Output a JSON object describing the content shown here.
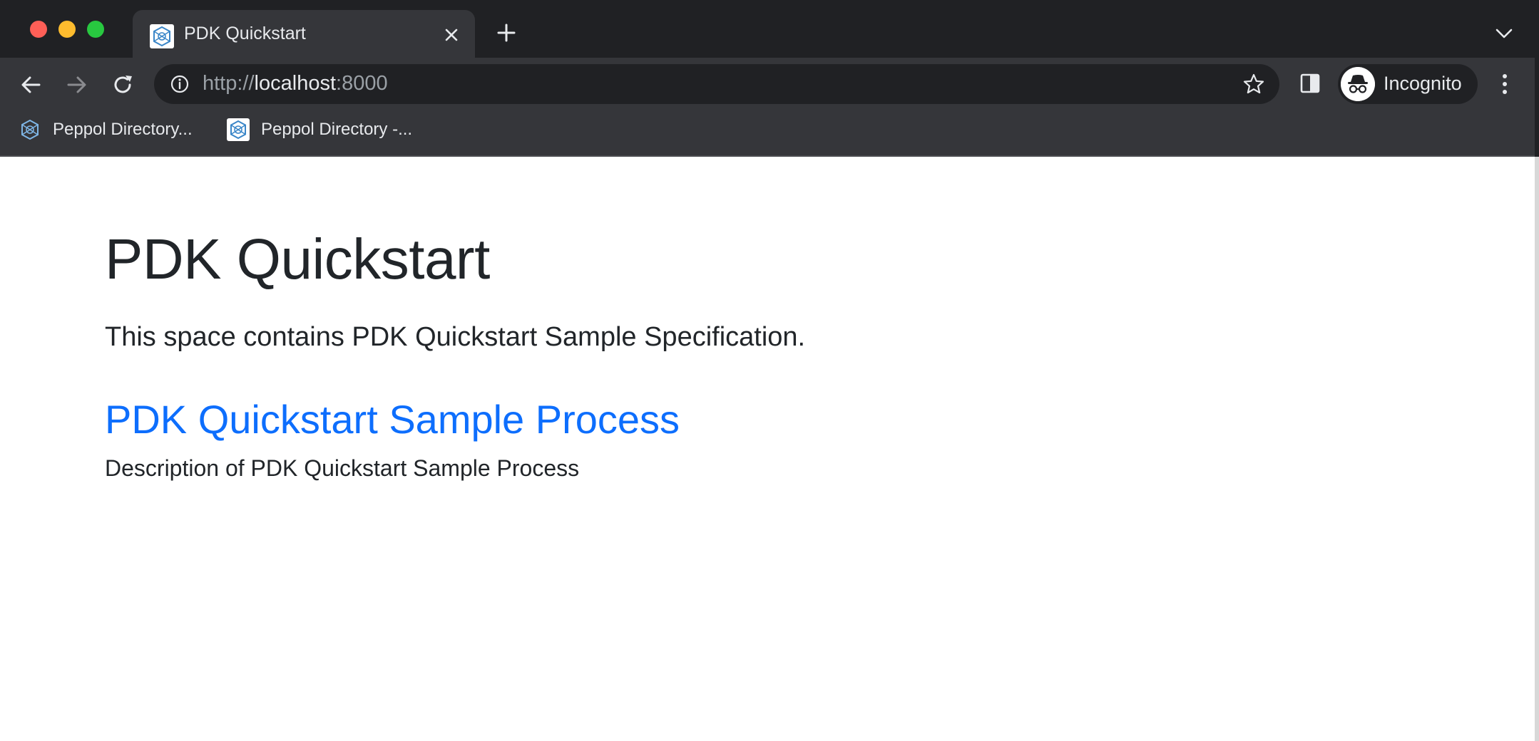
{
  "browser": {
    "tab": {
      "title": "PDK Quickstart"
    },
    "address_bar": {
      "scheme": "http://",
      "host": "localhost",
      "port": ":8000"
    },
    "profile_label": "Incognito",
    "bookmarks": [
      {
        "label": "Peppol Directory..."
      },
      {
        "label": "Peppol Directory -..."
      }
    ]
  },
  "page": {
    "title": "PDK Quickstart",
    "lead": "This space contains PDK Quickstart Sample Specification.",
    "process_link": "PDK Quickstart Sample Process",
    "process_description": "Description of PDK Quickstart Sample Process"
  },
  "colors": {
    "link": "#0d6efd",
    "text": "#212529",
    "chrome_dark": "#202124",
    "chrome_toolbar": "#35363a"
  }
}
